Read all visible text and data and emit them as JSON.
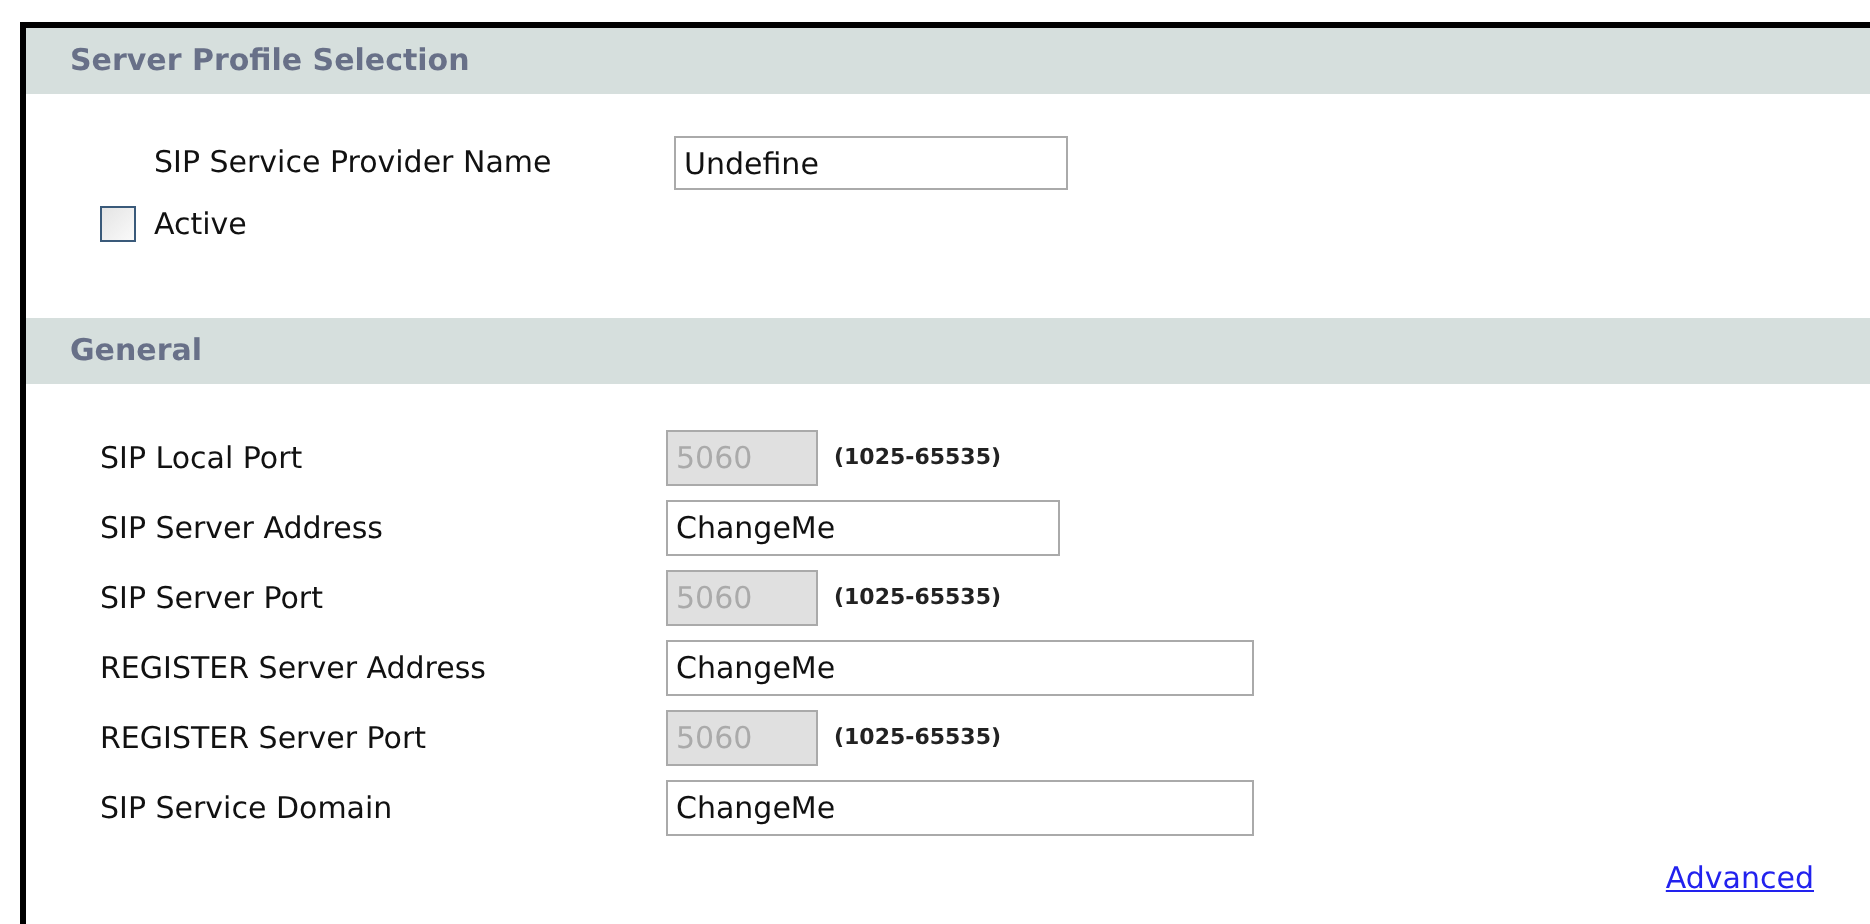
{
  "profile_section": {
    "title": "Server Profile Selection",
    "provider_name": {
      "label": "SIP Service Provider Name",
      "value": "Undefine"
    },
    "active": {
      "label": "Active",
      "checked": false
    }
  },
  "general_section": {
    "title": "General",
    "fields": [
      {
        "label": "SIP Local Port",
        "value": "5060",
        "kind": "port",
        "disabled": true,
        "hint": "(1025-65535)"
      },
      {
        "label": "SIP Server Address",
        "value": "ChangeMe",
        "kind": "short",
        "disabled": false
      },
      {
        "label": "SIP Server Port",
        "value": "5060",
        "kind": "port",
        "disabled": true,
        "hint": "(1025-65535)"
      },
      {
        "label": "REGISTER Server Address",
        "value": "ChangeMe",
        "kind": "long",
        "disabled": false
      },
      {
        "label": "REGISTER Server Port",
        "value": "5060",
        "kind": "port",
        "disabled": true,
        "hint": "(1025-65535)"
      },
      {
        "label": "SIP Service Domain",
        "value": "ChangeMe",
        "kind": "long",
        "disabled": false
      }
    ],
    "advanced_link": "Advanced"
  }
}
